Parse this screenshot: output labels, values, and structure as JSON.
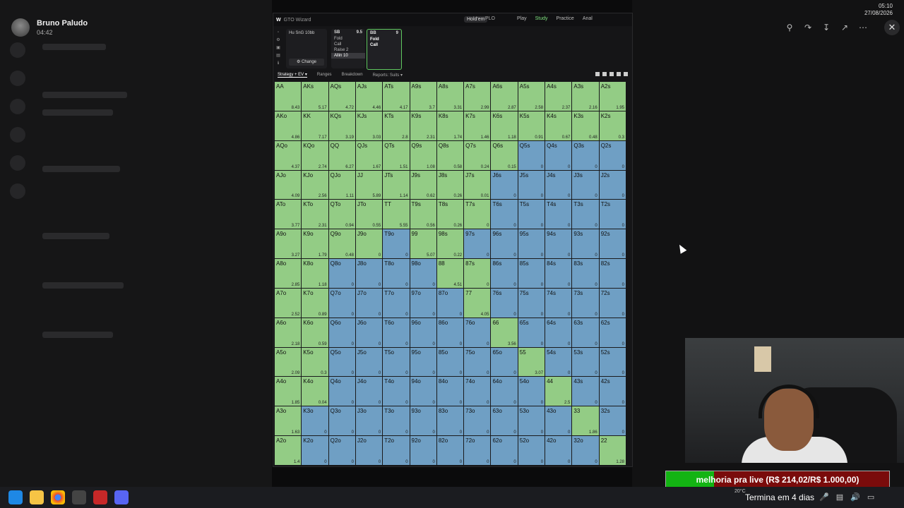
{
  "viewer": {
    "user_name": "Bruno Paludo",
    "time": "04:42"
  },
  "app": {
    "logo": "W",
    "title": "GTO Wizard",
    "game_pill": "Hold'em",
    "game_sub": "PLO",
    "nav": [
      "Play",
      "Study",
      "Practice",
      "Anal"
    ],
    "game_box": {
      "title": "Hu SnG 10bb",
      "change_label": "Change"
    },
    "positions": [
      {
        "name": "SB",
        "stack": "9.5",
        "actions": [
          "Fold",
          "Call",
          "Raise 2",
          "Allin 10"
        ]
      },
      {
        "name": "BB",
        "stack": "9",
        "actions": [
          "Fold",
          "Call"
        ]
      }
    ],
    "tabs": [
      "Strategy + EV",
      "Ranges",
      "Breakdown",
      "Reports: Suits"
    ]
  },
  "colors": {
    "call": "#93cc85",
    "fold": "#6f9fc4",
    "selected": "#5fc85f",
    "goal_fill": "#13b413",
    "goal_bg": "#7a0b0b"
  },
  "chart_data": {
    "type": "heatmap",
    "ranks": [
      "A",
      "K",
      "Q",
      "J",
      "T",
      "9",
      "8",
      "7",
      "6",
      "5",
      "4",
      "3",
      "2"
    ],
    "rows": [
      {
        "hands": [
          "AA",
          "AKs",
          "AQs",
          "AJs",
          "ATs",
          "A9s",
          "A8s",
          "A7s",
          "A6s",
          "A5s",
          "A4s",
          "A3s",
          "A2s"
        ],
        "ev": [
          "8.43",
          "5.17",
          "4.72",
          "4.46",
          "4.17",
          "3.7",
          "3.31",
          "2.99",
          "2.87",
          "2.58",
          "2.37",
          "2.16",
          "1.95"
        ],
        "call": [
          1,
          1,
          1,
          1,
          1,
          1,
          1,
          1,
          1,
          1,
          1,
          1,
          1
        ]
      },
      {
        "hands": [
          "AKo",
          "KK",
          "KQs",
          "KJs",
          "KTs",
          "K9s",
          "K8s",
          "K7s",
          "K6s",
          "K5s",
          "K4s",
          "K3s",
          "K2s"
        ],
        "ev": [
          "4.86",
          "7.17",
          "3.19",
          "3.03",
          "2.8",
          "2.31",
          "1.74",
          "1.46",
          "1.18",
          "0.91",
          "0.67",
          "0.48",
          "0.3"
        ],
        "call": [
          1,
          1,
          1,
          1,
          1,
          1,
          1,
          1,
          1,
          1,
          1,
          1,
          1
        ]
      },
      {
        "hands": [
          "AQo",
          "KQo",
          "QQ",
          "QJs",
          "QTs",
          "Q9s",
          "Q8s",
          "Q7s",
          "Q6s",
          "Q5s",
          "Q4s",
          "Q3s",
          "Q2s"
        ],
        "ev": [
          "4.37",
          "2.74",
          "6.27",
          "1.67",
          "1.51",
          "1.08",
          "0.58",
          "0.24",
          "0.15",
          "0",
          "0",
          "0",
          "0"
        ],
        "call": [
          1,
          1,
          1,
          1,
          1,
          1,
          1,
          1,
          1,
          0,
          0,
          0,
          0
        ]
      },
      {
        "hands": [
          "AJo",
          "KJo",
          "QJo",
          "JJ",
          "JTs",
          "J9s",
          "J8s",
          "J7s",
          "J6s",
          "J5s",
          "J4s",
          "J3s",
          "J2s"
        ],
        "ev": [
          "4.09",
          "2.56",
          "1.11",
          "5.89",
          "1.14",
          "0.62",
          "0.26",
          "0.01",
          "0",
          "0",
          "0",
          "0",
          "0"
        ],
        "call": [
          1,
          1,
          1,
          1,
          1,
          1,
          1,
          1,
          0,
          0,
          0,
          0,
          0
        ]
      },
      {
        "hands": [
          "ATo",
          "KTo",
          "QTo",
          "JTo",
          "TT",
          "T9s",
          "T8s",
          "T7s",
          "T6s",
          "T5s",
          "T4s",
          "T3s",
          "T2s"
        ],
        "ev": [
          "3.77",
          "2.31",
          "0.94",
          "0.55",
          "5.55",
          "0.56",
          "0.26",
          "0",
          "0",
          "0",
          "0",
          "0",
          "0"
        ],
        "call": [
          1,
          1,
          1,
          1,
          1,
          1,
          1,
          1,
          0,
          0,
          0,
          0,
          0
        ]
      },
      {
        "hands": [
          "A9o",
          "K9o",
          "Q9o",
          "J9o",
          "T9o",
          "99",
          "98s",
          "97s",
          "96s",
          "95s",
          "94s",
          "93s",
          "92s"
        ],
        "ev": [
          "3.27",
          "1.79",
          "0.48",
          "0",
          "0",
          "5.07",
          "0.22",
          "0",
          "0",
          "0",
          "0",
          "0",
          "0"
        ],
        "call": [
          1,
          1,
          1,
          1,
          0,
          1,
          1,
          0,
          0,
          0,
          0,
          0,
          0
        ]
      },
      {
        "hands": [
          "A8o",
          "K8o",
          "Q8o",
          "J8o",
          "T8o",
          "98o",
          "88",
          "87s",
          "86s",
          "85s",
          "84s",
          "83s",
          "82s"
        ],
        "ev": [
          "2.85",
          "1.18",
          "0",
          "0",
          "0",
          "0",
          "4.51",
          "0",
          "0",
          "0",
          "0",
          "0",
          "0"
        ],
        "call": [
          1,
          1,
          0,
          0,
          0,
          0,
          1,
          1,
          0,
          0,
          0,
          0,
          0
        ]
      },
      {
        "hands": [
          "A7o",
          "K7o",
          "Q7o",
          "J7o",
          "T7o",
          "97o",
          "87o",
          "77",
          "76s",
          "75s",
          "74s",
          "73s",
          "72s"
        ],
        "ev": [
          "2.52",
          "0.89",
          "0",
          "0",
          "0",
          "0",
          "0",
          "4.05",
          "0",
          "0",
          "0",
          "0",
          "0"
        ],
        "call": [
          1,
          1,
          0,
          0,
          0,
          0,
          0,
          1,
          0,
          0,
          0,
          0,
          0
        ]
      },
      {
        "hands": [
          "A6o",
          "K6o",
          "Q6o",
          "J6o",
          "T6o",
          "96o",
          "86o",
          "76o",
          "66",
          "65s",
          "64s",
          "63s",
          "62s"
        ],
        "ev": [
          "2.18",
          "0.59",
          "0",
          "0",
          "0",
          "0",
          "0",
          "0",
          "3.56",
          "0",
          "0",
          "0",
          "0"
        ],
        "call": [
          1,
          1,
          0,
          0,
          0,
          0,
          0,
          0,
          1,
          0,
          0,
          0,
          0
        ]
      },
      {
        "hands": [
          "A5o",
          "K5o",
          "Q5o",
          "J5o",
          "T5o",
          "95o",
          "85o",
          "75o",
          "65o",
          "55",
          "54s",
          "53s",
          "52s"
        ],
        "ev": [
          "2.09",
          "0.3",
          "0",
          "0",
          "0",
          "0",
          "0",
          "0",
          "0",
          "3.07",
          "0",
          "0",
          "0"
        ],
        "call": [
          1,
          1,
          0,
          0,
          0,
          0,
          0,
          0,
          0,
          1,
          0,
          0,
          0
        ]
      },
      {
        "hands": [
          "A4o",
          "K4o",
          "Q4o",
          "J4o",
          "T4o",
          "94o",
          "84o",
          "74o",
          "64o",
          "54o",
          "44",
          "43s",
          "42s"
        ],
        "ev": [
          "1.85",
          "0.04",
          "0",
          "0",
          "0",
          "0",
          "0",
          "0",
          "0",
          "0",
          "2.5",
          "0",
          "0"
        ],
        "call": [
          1,
          1,
          0,
          0,
          0,
          0,
          0,
          0,
          0,
          0,
          1,
          0,
          0
        ]
      },
      {
        "hands": [
          "A3o",
          "K3o",
          "Q3o",
          "J3o",
          "T3o",
          "93o",
          "83o",
          "73o",
          "63o",
          "53o",
          "43o",
          "33",
          "32s"
        ],
        "ev": [
          "1.63",
          "0",
          "0",
          "0",
          "0",
          "0",
          "0",
          "0",
          "0",
          "0",
          "0",
          "1.86",
          "0"
        ],
        "call": [
          1,
          0,
          0,
          0,
          0,
          0,
          0,
          0,
          0,
          0,
          0,
          1,
          0
        ]
      },
      {
        "hands": [
          "A2o",
          "K2o",
          "Q2o",
          "J2o",
          "T2o",
          "92o",
          "82o",
          "72o",
          "62o",
          "52o",
          "42o",
          "32o",
          "22"
        ],
        "ev": [
          "1.4",
          "0",
          "0",
          "0",
          "0",
          "0",
          "0",
          "0",
          "0",
          "0",
          "0",
          "0",
          "1.28"
        ],
        "call": [
          1,
          0,
          0,
          0,
          0,
          0,
          0,
          0,
          0,
          0,
          0,
          0,
          1
        ]
      }
    ]
  },
  "overlay": {
    "goal_text": "melhoria pra live (R$ 214,02/R$ 1.000,00)",
    "goal_progress": 0.214
  },
  "taskbar": {
    "weather_temp": "20°C",
    "news": "Termina em 4 dias",
    "time": "05:10",
    "date": "27/08/2026"
  }
}
